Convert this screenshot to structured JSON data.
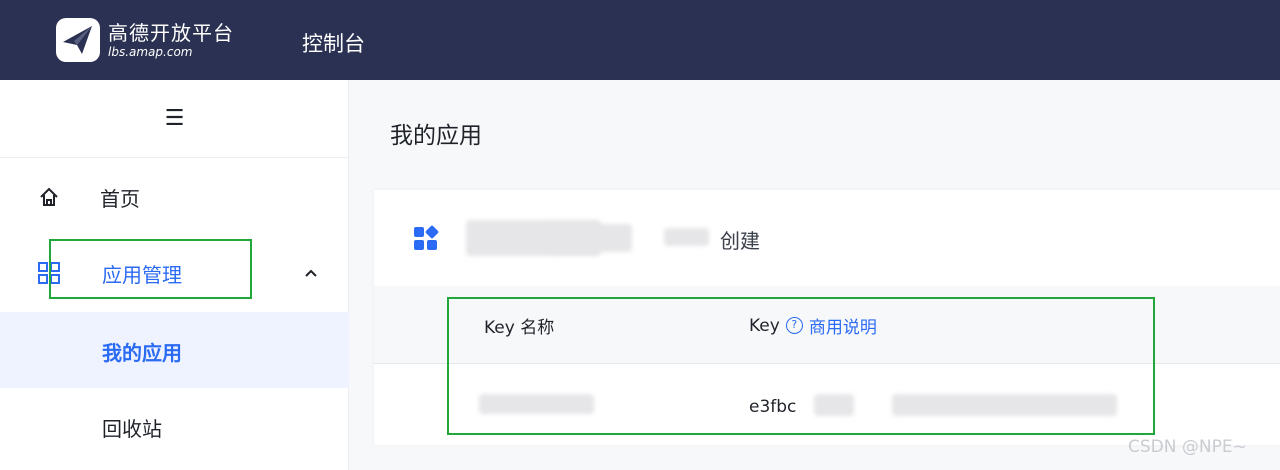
{
  "header": {
    "logo_title": "高德开放平台",
    "logo_sub": "lbs.amap.com",
    "console_title": "控制台"
  },
  "sidebar": {
    "menu_toggle": "☰",
    "items": [
      {
        "label": "首页",
        "icon": "home-icon"
      },
      {
        "label": "应用管理",
        "icon": "grid-icon",
        "expanded": true
      },
      {
        "label": "我的应用",
        "selected": true
      },
      {
        "label": "回收站"
      }
    ]
  },
  "main": {
    "page_title": "我的应用",
    "card": {
      "created_text": "创建",
      "table": {
        "col_name": "Key 名称",
        "col_key": "Key",
        "help_link": "商用说明",
        "row_key_prefix": "e3fbc"
      }
    }
  },
  "watermark": "CSDN @NPE~",
  "colors": {
    "topbar": "#2b3152",
    "accent": "#2b6bf3",
    "highlight_box": "#22a83a"
  }
}
